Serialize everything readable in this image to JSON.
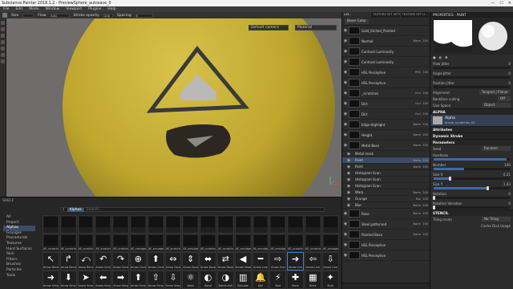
{
  "window": {
    "title": "Substance Painter 2018.1.2 - PreviewSphere_autosave_0",
    "controls": [
      "—",
      "☐",
      "✕"
    ]
  },
  "menu": [
    "File",
    "Edit",
    "Mode",
    "Window",
    "Viewport",
    "Plugins",
    "Help"
  ],
  "toolbar": {
    "size_label": "Size",
    "flow_label": "Flow",
    "flow_value": "100",
    "stroke_opacity_label": "Stroke opacity",
    "stroke_opacity_value": "100",
    "spacing_label": "Spacing",
    "spacing_value": "5"
  },
  "viewport": {
    "camera": "Default camera",
    "mode": "Material"
  },
  "shelf": {
    "title": "SHELF",
    "categories": [
      "All",
      "Project",
      "Alphas",
      "Grunges",
      "Procedurals",
      "Textures",
      "Hard Surfaces",
      "Skin",
      "Filters",
      "Brushes",
      "Particles",
      "Tools"
    ],
    "selected_category": "Alphas",
    "filter_chip": "Alphas",
    "search_placeholder": "Search...",
    "rows": [
      [
        "",
        "",
        "",
        "",
        "",
        "",
        "",
        "",
        "",
        "",
        "",
        "",
        "",
        "",
        "",
        "",
        ""
      ],
      [
        "AE_scratches",
        "AE_scratches",
        "AE_scratches",
        "AE_scratches",
        "AE_scratches",
        "AE_smudges",
        "AE_smudges",
        "AE_scratches",
        "AE_smudges",
        "AE_scratches",
        "AE_scratches",
        "AE_smudges",
        "AE_smudges",
        "AE_smudges",
        "AE_scratches",
        "AE_scratches",
        "AE_smudges"
      ],
      [
        "Arrow Bend",
        "Arrow Bend",
        "Arrow Bend",
        "Arrow Circle",
        "Arrow Circle",
        "Arrow Circle",
        "Arrow Circle",
        "Arrow Double",
        "Arrow Double",
        "Arrow Double",
        "Arrow Double",
        "Arrow Head",
        "Arrow Line",
        "Arrow Line",
        "Arrow Line",
        "Arrow Line",
        "Arrow Line"
      ],
      [
        "Arrow Simpl",
        "Arrow Simpl",
        "Arrow Simpl",
        "Arrow Simpl",
        "Arrow Simpl",
        "Arrow Simpl",
        "Arrow Simpl",
        "Arrow Simpl",
        "Atom",
        "Band",
        "Barrel Half",
        "Barcode",
        "Bell",
        "Bolt",
        "Bone",
        "Brick",
        "Bulb"
      ]
    ],
    "glyphs": [
      [
        "",
        "",
        "",
        "",
        "",
        "",
        "",
        "",
        "",
        "",
        "",
        "",
        "",
        "",
        "",
        "",
        ""
      ],
      [
        "",
        "",
        "",
        "",
        "",
        "",
        "",
        "",
        "",
        "",
        "",
        "",
        "",
        "",
        "",
        "",
        ""
      ],
      [
        "↖",
        "↱",
        "⤺",
        "↶",
        "↷",
        "⊕",
        "⬆",
        "⇔",
        "⇕",
        "⬌",
        "⇄",
        "◀",
        "━",
        "⇨",
        "➔",
        "⇦",
        "⇩"
      ],
      [
        "➜",
        "⬇",
        "➤",
        "⬅",
        "➡",
        "⬆",
        "⇧",
        "⇩",
        "⚛",
        "◐",
        "◑",
        "▥",
        "🔔",
        "⚡",
        "✚",
        "▦",
        "✦"
      ]
    ]
  },
  "layers": {
    "tabs": [
      "LAY...",
      "TEXTURE SET SETTIN...",
      "TEXTURE SET LI..."
    ],
    "channel": "Base Color",
    "items": [
      {
        "name": "Gold_Etched_Painted",
        "blend": "",
        "opacity": "",
        "indent": 0,
        "sel": false
      },
      {
        "name": "Normal",
        "blend": "Norm",
        "opacity": "100",
        "indent": 0,
        "sel": false
      },
      {
        "name": "Contrast Luminosity",
        "blend": "",
        "opacity": "",
        "indent": 0,
        "sel": false
      },
      {
        "name": "Contrast Luminosity",
        "blend": "",
        "opacity": "",
        "indent": 0,
        "sel": false
      },
      {
        "name": "HSL Perceptive",
        "blend": "Pthr",
        "opacity": "100",
        "indent": 0,
        "sel": false
      },
      {
        "name": "HSL Perceptive",
        "blend": "",
        "opacity": "",
        "indent": 0,
        "sel": false
      },
      {
        "name": "_scratches",
        "blend": "Ovrl",
        "opacity": "100",
        "indent": 0,
        "sel": false
      },
      {
        "name": "Dirt",
        "blend": "Ovrl",
        "opacity": "100",
        "indent": 0,
        "sel": false
      },
      {
        "name": "Dirt",
        "blend": "Ovrl",
        "opacity": "100",
        "indent": 0,
        "sel": false
      },
      {
        "name": "Edge Highlight",
        "blend": "Norm",
        "opacity": "100",
        "indent": 0,
        "sel": false
      },
      {
        "name": "Height",
        "blend": "Norm",
        "opacity": "100",
        "indent": 0,
        "sel": false
      },
      {
        "name": "Metal Base",
        "blend": "Norm",
        "opacity": "100",
        "indent": 0,
        "sel": false
      },
      {
        "name": "Metal mask",
        "blend": "",
        "opacity": "",
        "indent": 1,
        "sel": false
      },
      {
        "name": "Paint",
        "blend": "Norm",
        "opacity": "100",
        "indent": 1,
        "sel": true
      },
      {
        "name": "Paint",
        "blend": "Norm",
        "opacity": "100",
        "indent": 1,
        "sel": false
      },
      {
        "name": "Histogram Scan",
        "blend": "",
        "opacity": "",
        "indent": 1,
        "sel": false
      },
      {
        "name": "Histogram Scan",
        "blend": "",
        "opacity": "",
        "indent": 1,
        "sel": false
      },
      {
        "name": "Histogram Scan",
        "blend": "",
        "opacity": "",
        "indent": 1,
        "sel": false
      },
      {
        "name": "Warp",
        "blend": "Norm",
        "opacity": "100",
        "indent": 1,
        "sel": false
      },
      {
        "name": "Grunge",
        "blend": "Mul",
        "opacity": "100",
        "indent": 1,
        "sel": false
      },
      {
        "name": "Blur",
        "blend": "Norm",
        "opacity": "100",
        "indent": 1,
        "sel": false
      },
      {
        "name": "Rose",
        "blend": "Norm",
        "opacity": "100",
        "indent": 0,
        "sel": false
      },
      {
        "name": "Steel patterned",
        "blend": "Norm",
        "opacity": "100",
        "indent": 0,
        "sel": false
      },
      {
        "name": "Painted Base",
        "blend": "Norm",
        "opacity": "100",
        "indent": 0,
        "sel": false
      },
      {
        "name": "HSL Perceptive",
        "blend": "",
        "opacity": "",
        "indent": 0,
        "sel": false
      },
      {
        "name": "HSL Perceptive",
        "blend": "",
        "opacity": "",
        "indent": 0,
        "sel": false
      }
    ]
  },
  "properties": {
    "title": "PROPERTIES - PAINT",
    "rows": [
      {
        "label": "Flow Jitter",
        "value": "0"
      },
      {
        "label": "Angle Jitter",
        "value": "0"
      },
      {
        "label": "Position Jitter",
        "value": "0"
      }
    ],
    "alignment_label": "Alignment",
    "alignment_value": "Tangent | Planar",
    "backface_label": "Backface culling",
    "backface_value": "Off",
    "sizespace_label": "Size Space",
    "sizespace_value": "Object",
    "alpha_section": "ALPHA",
    "alpha_name": "Alpha",
    "alpha_file": "dump_scratches_01",
    "attributes": "Attributes",
    "dynamic_stroke": "Dynamic Stroke",
    "parameters": "Parameters",
    "seed_label": "Seed",
    "seed_value": "Random",
    "hardness_label": "Hardness",
    "number_label": "Number",
    "number_value": "100",
    "params": [
      {
        "label": "Size X",
        "value": "0.21",
        "level": 0.21
      },
      {
        "label": "Size Y",
        "value": "1.43",
        "level": 0.7
      },
      {
        "label": "Rotation",
        "value": "0",
        "level": 0
      },
      {
        "label": "Rotation Variation",
        "value": "0",
        "level": 0
      }
    ],
    "stencil_section": "STENCIL",
    "tiling_label": "Tiling mode",
    "tiling_value": "No Tiling",
    "cache": "Cache Disk Usage"
  }
}
